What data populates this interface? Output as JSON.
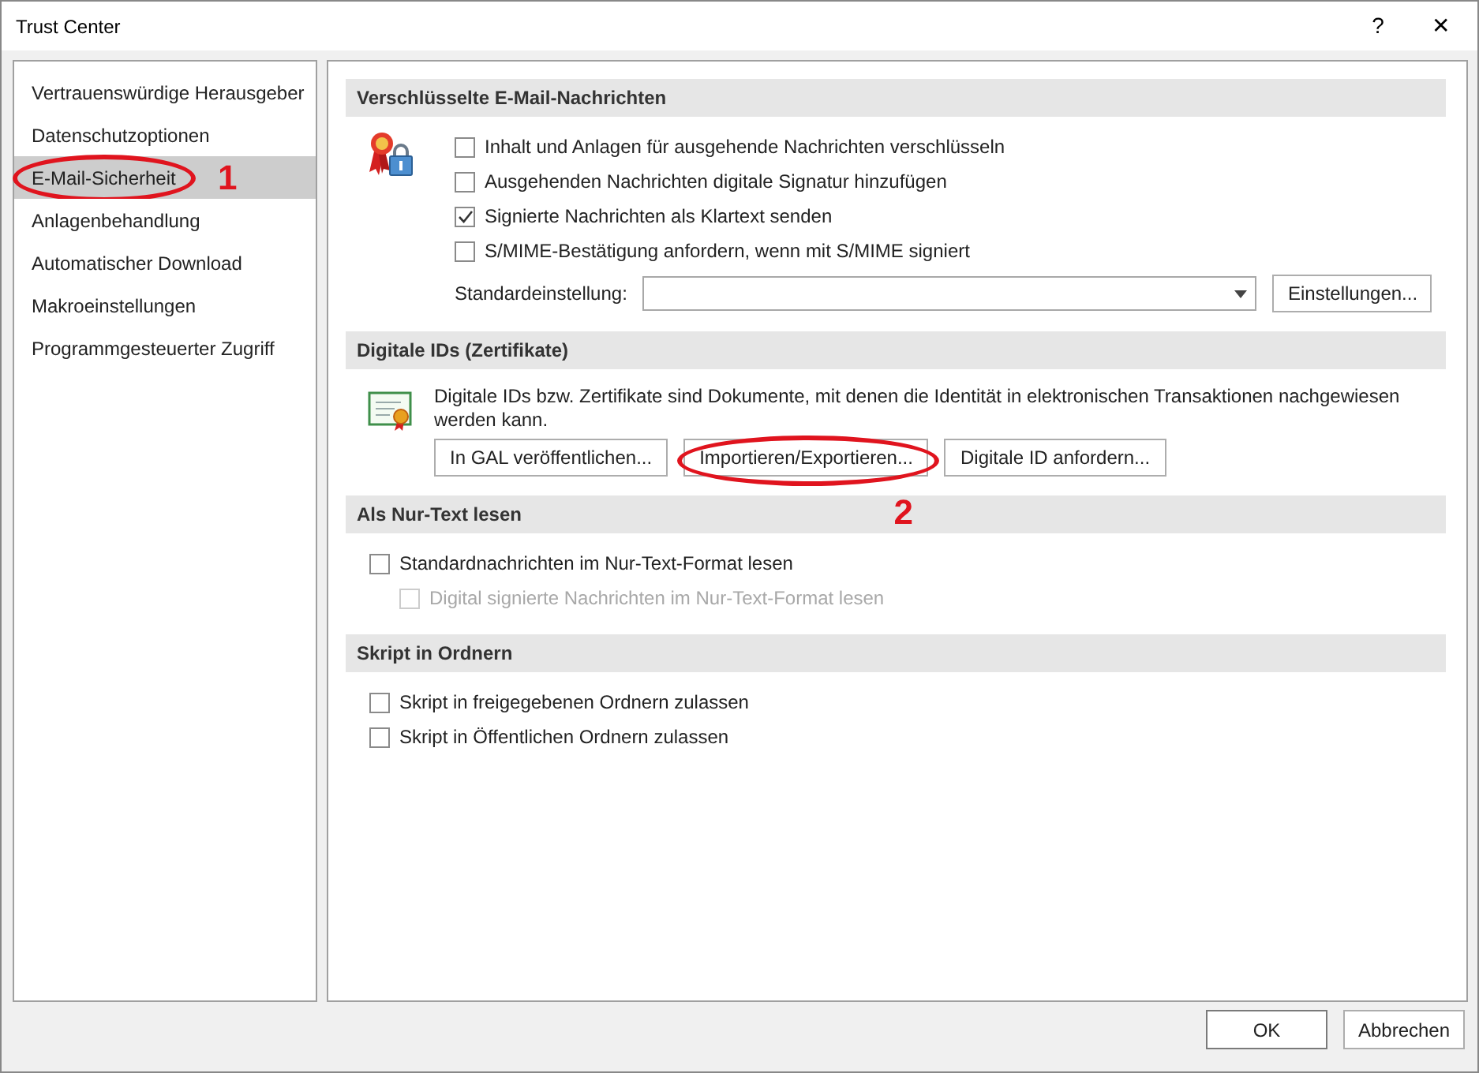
{
  "window": {
    "title": "Trust Center",
    "help": "?",
    "close": "✕"
  },
  "sidebar": {
    "items": [
      {
        "label": "Vertrauenswürdige Herausgeber",
        "selected": false
      },
      {
        "label": "Datenschutzoptionen",
        "selected": false
      },
      {
        "label": "E-Mail-Sicherheit",
        "selected": true,
        "callout": "1"
      },
      {
        "label": "Anlagenbehandlung",
        "selected": false
      },
      {
        "label": "Automatischer Download",
        "selected": false
      },
      {
        "label": "Makroeinstellungen",
        "selected": false
      },
      {
        "label": "Programmgesteuerter Zugriff",
        "selected": false
      }
    ]
  },
  "sections": [
    {
      "kind": "encryption",
      "title": "Verschlüsselte E-Mail-Nachrichten",
      "options": [
        {
          "label": "Inhalt und Anlagen für ausgehende Nachrichten verschlüsseln",
          "checked": false,
          "disabled": false
        },
        {
          "label": "Ausgehenden Nachrichten digitale Signatur hinzufügen",
          "checked": false,
          "disabled": false
        },
        {
          "label": "Signierte Nachrichten als Klartext senden",
          "checked": true,
          "disabled": false
        },
        {
          "label": "S/MIME-Bestätigung anfordern, wenn mit S/MIME signiert",
          "checked": false,
          "disabled": false
        }
      ],
      "default_setting": {
        "label": "Standardeinstellung:",
        "button": "Einstellungen..."
      }
    },
    {
      "kind": "ids",
      "title": "Digitale IDs (Zertifikate)",
      "description": "Digitale IDs bzw. Zertifikate sind Dokumente, mit denen die Identität in elektronischen Transaktionen nachgewiesen werden kann.",
      "buttons": [
        {
          "label": "In GAL veröffentlichen..."
        },
        {
          "label": "Importieren/Exportieren...",
          "callout": "2"
        },
        {
          "label": "Digitale ID anfordern..."
        }
      ]
    },
    {
      "kind": "options",
      "title": "Als Nur-Text lesen",
      "options": [
        {
          "label": "Standardnachrichten im Nur-Text-Format lesen",
          "checked": false,
          "disabled": false,
          "children": [
            {
              "label": "Digital signierte Nachrichten im Nur-Text-Format lesen",
              "checked": false,
              "disabled": true
            }
          ]
        }
      ]
    },
    {
      "kind": "options",
      "title": "Skript in Ordnern",
      "options": [
        {
          "label": "Skript in freigegebenen Ordnern zulassen",
          "checked": false,
          "disabled": false
        },
        {
          "label": "Skript in Öffentlichen Ordnern zulassen",
          "checked": false,
          "disabled": false
        }
      ]
    }
  ],
  "footer": {
    "buttons": [
      "OK",
      "Abbrechen"
    ]
  }
}
